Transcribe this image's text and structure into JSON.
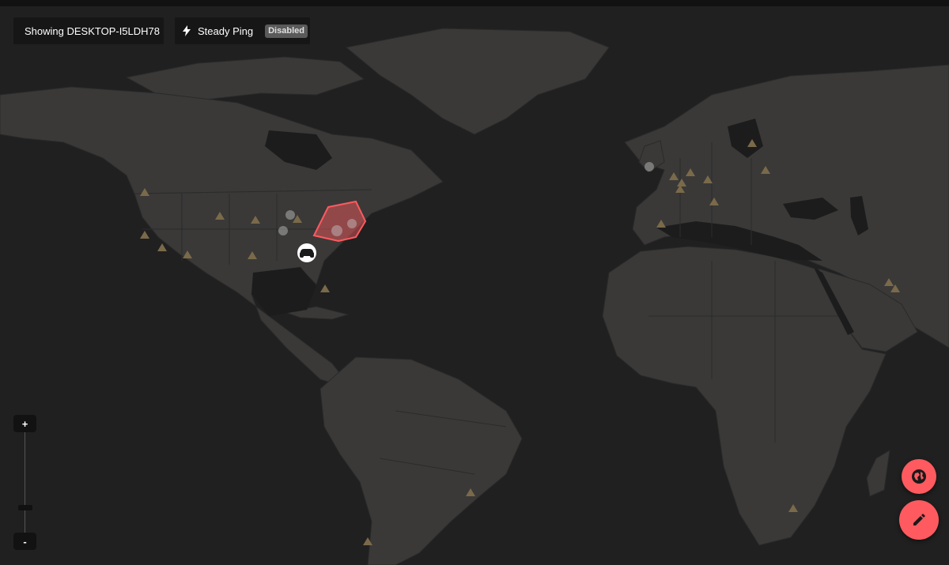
{
  "header": {
    "device_label": "Showing DESKTOP-I5LDH78",
    "ping_label": "Steady Ping",
    "ping_status": "Disabled"
  },
  "zoom": {
    "plus_label": "+",
    "minus_label": "-",
    "level": 0.25
  },
  "icons": {
    "ping": "lightning-bolt-icon",
    "player": "gamepad-icon",
    "region": "globe-icon",
    "edit": "pencil-icon"
  },
  "colors": {
    "land": "#3a3938",
    "ocean": "#202020",
    "server_marker": "#7a6a4a",
    "accent": "#ff5a5f",
    "badge": "#5a5a5a"
  }
}
